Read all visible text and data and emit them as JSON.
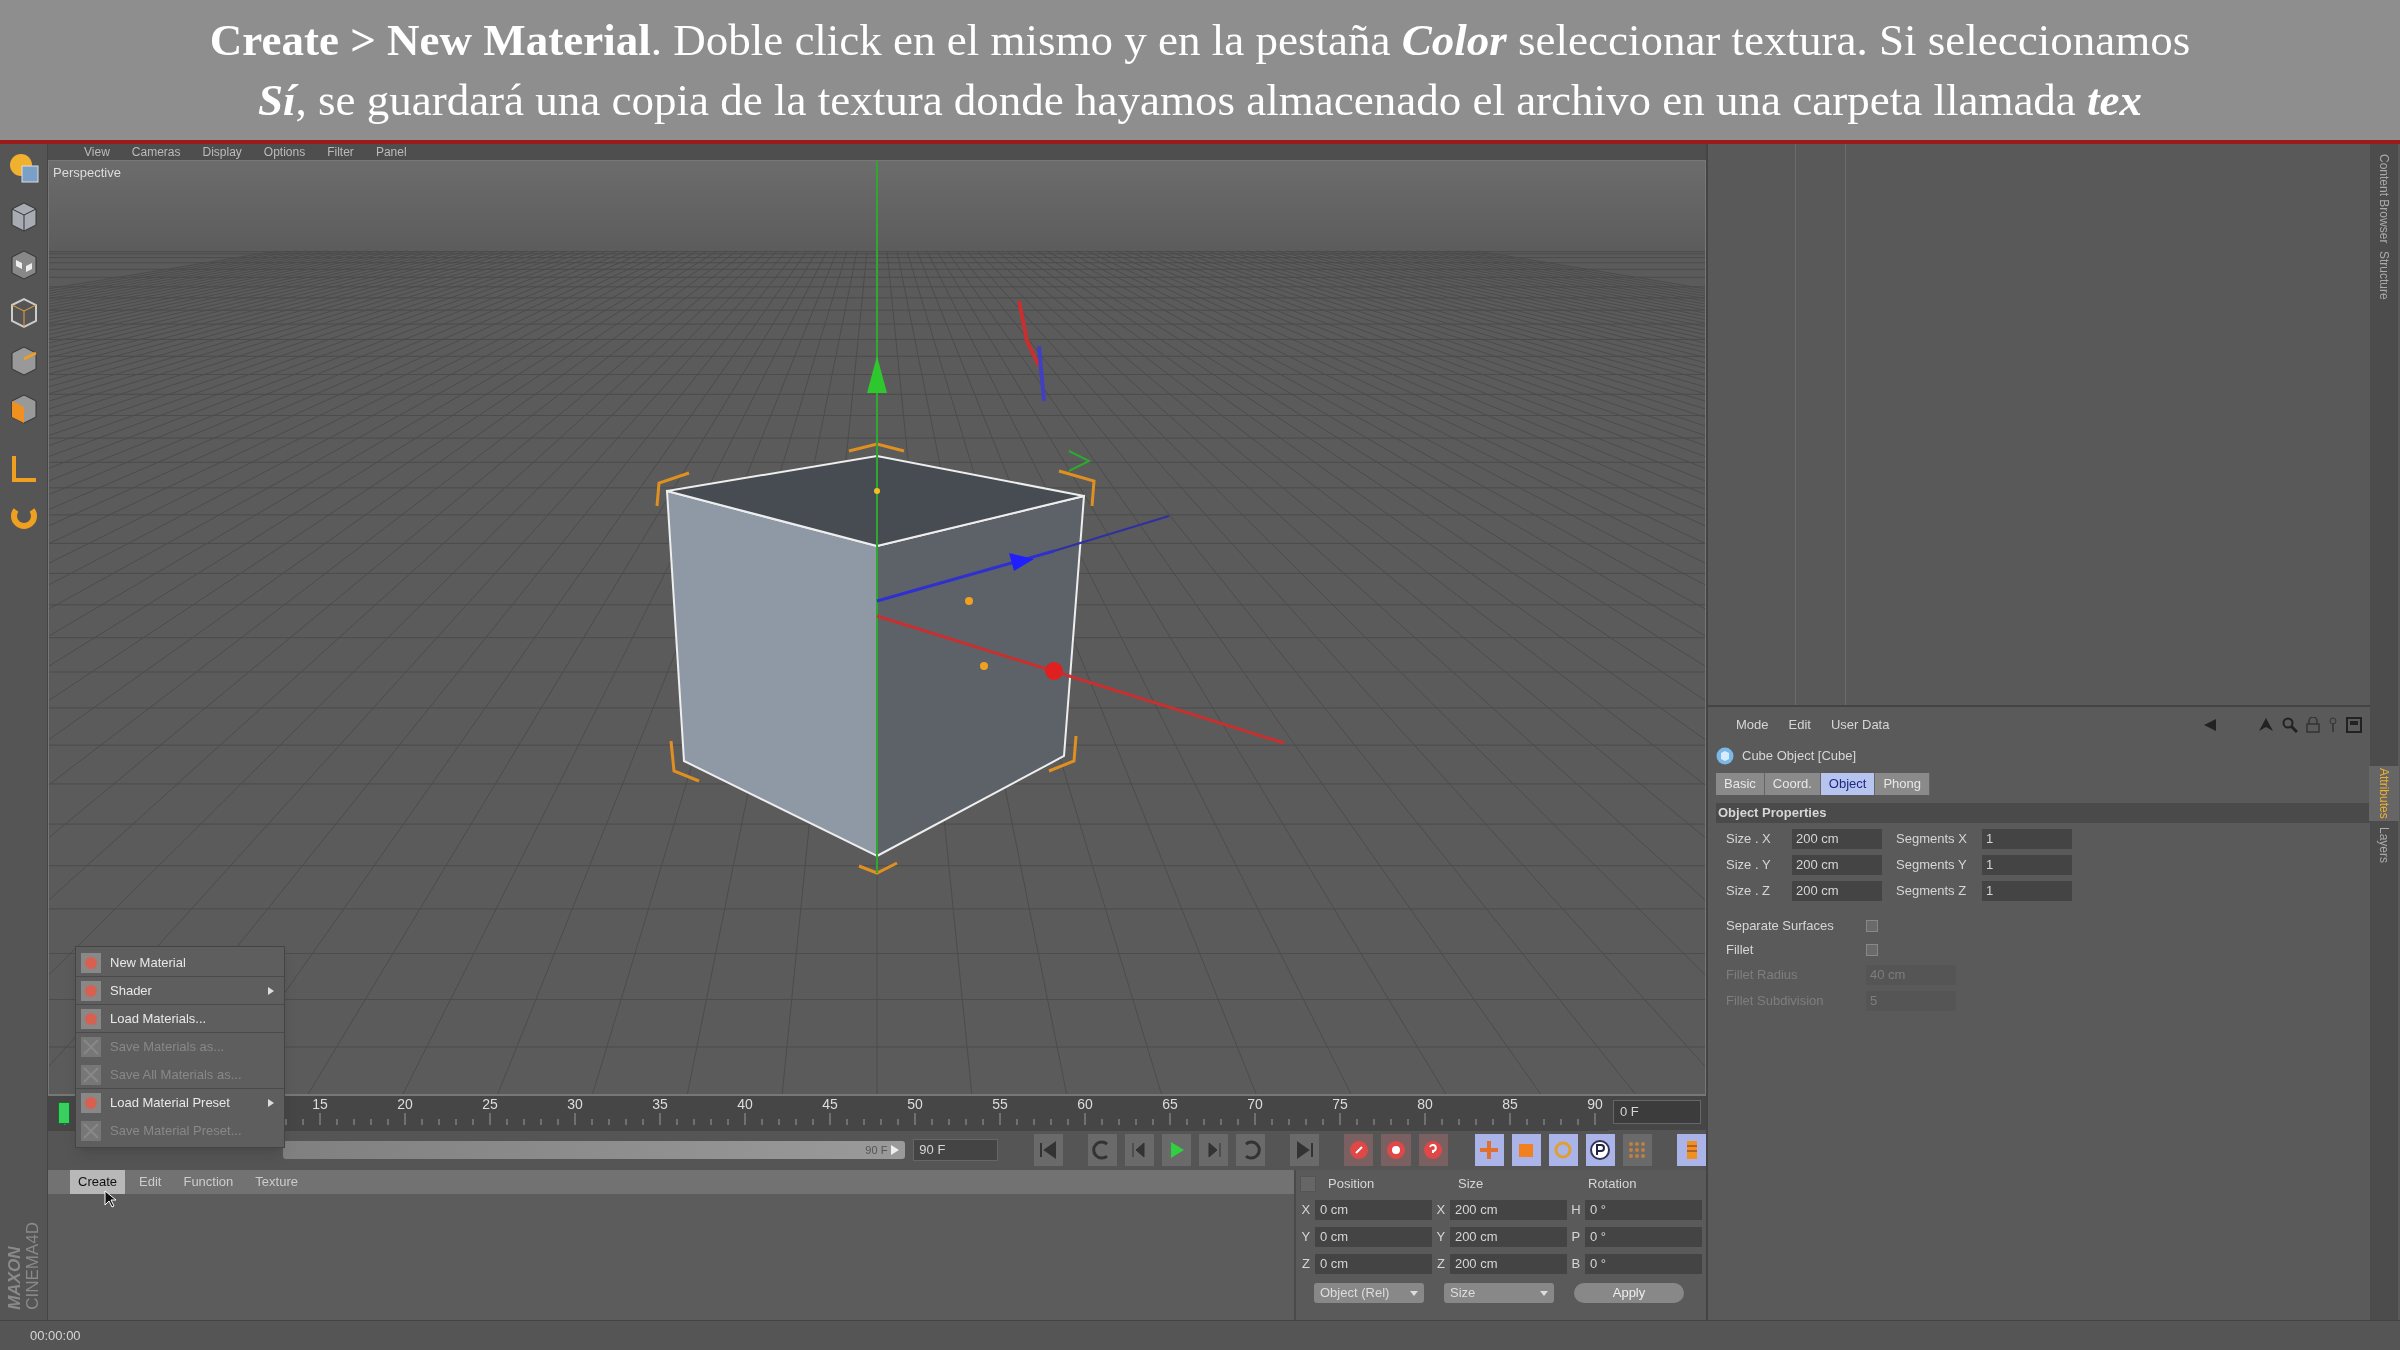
{
  "caption": {
    "lines": [
      "**Create > New Material**.  Doble click en el mismo y en la pestaña *Color* seleccionar textura. Si seleccionamos",
      "*Sí*, se guardará una copia de la textura donde hayamos almacenado el archivo en una carpeta llamada *tex*"
    ]
  },
  "viewport": {
    "menu": [
      "View",
      "Cameras",
      "Display",
      "Options",
      "Filter",
      "Panel"
    ],
    "label": "Perspective"
  },
  "create_menu": {
    "items": [
      {
        "label": "New Material",
        "disabled": false,
        "submenu": false,
        "separator_after": true
      },
      {
        "label": "Shader",
        "disabled": false,
        "submenu": true,
        "separator_after": true
      },
      {
        "label": "Load Materials...",
        "disabled": false,
        "submenu": false,
        "separator_after": true
      },
      {
        "label": "Save Materials as...",
        "disabled": true,
        "submenu": false,
        "separator_after": false
      },
      {
        "label": "Save All Materials as...",
        "disabled": true,
        "submenu": false,
        "separator_after": true
      },
      {
        "label": "Load Material Preset",
        "disabled": false,
        "submenu": true,
        "separator_after": false
      },
      {
        "label": "Save Material Preset...",
        "disabled": true,
        "submenu": false,
        "separator_after": false
      }
    ]
  },
  "timeline": {
    "labels": [
      "15",
      "20",
      "25",
      "30",
      "35",
      "40",
      "45",
      "50",
      "55",
      "60",
      "65",
      "70",
      "75",
      "80",
      "85",
      "90"
    ],
    "current_frame": "0 F"
  },
  "transport": {
    "slider_end": "90 F",
    "end_frame": "90 F"
  },
  "material_manager": {
    "menu": [
      {
        "label": "Create",
        "selected": true
      },
      {
        "label": "Edit",
        "selected": false
      },
      {
        "label": "Function",
        "selected": false
      },
      {
        "label": "Texture",
        "selected": false
      }
    ]
  },
  "coordinates": {
    "checked": false,
    "headers": [
      "Position",
      "Size",
      "Rotation"
    ],
    "rows": [
      {
        "axis": "X",
        "position": "0 cm",
        "size_axis": "X",
        "size": "200 cm",
        "rotation_axis": "H",
        "rotation": "0 °"
      },
      {
        "axis": "Y",
        "position": "0 cm",
        "size_axis": "Y",
        "size": "200 cm",
        "rotation_axis": "P",
        "rotation": "0 °"
      },
      {
        "axis": "Z",
        "position": "0 cm",
        "size_axis": "Z",
        "size": "200 cm",
        "rotation_axis": "B",
        "rotation": "0 °"
      }
    ],
    "mode": "Object (Rel)",
    "size_mode": "Size",
    "apply": "Apply"
  },
  "attributes": {
    "menu": [
      "Mode",
      "Edit",
      "User Data"
    ],
    "title": "Cube Object [Cube]",
    "tabs": [
      {
        "label": "Basic",
        "selected": false
      },
      {
        "label": "Coord.",
        "selected": false
      },
      {
        "label": "Object",
        "selected": true
      },
      {
        "label": "Phong",
        "selected": false
      }
    ],
    "section": "Object Properties",
    "size_rows": [
      {
        "label": "Size . X",
        "value": "200 cm",
        "seg_label": "Segments X",
        "seg_value": "1"
      },
      {
        "label": "Size . Y",
        "value": "200 cm",
        "seg_label": "Segments Y",
        "seg_value": "1"
      },
      {
        "label": "Size . Z",
        "value": "200 cm",
        "seg_label": "Segments Z",
        "seg_value": "1"
      }
    ],
    "checks": [
      {
        "label": "Separate Surfaces",
        "checked": false
      },
      {
        "label": "Fillet",
        "checked": false
      }
    ],
    "fillet": [
      {
        "label": "Fillet Radius",
        "value": "40 cm",
        "disabled": true
      },
      {
        "label": "Fillet Subdivision",
        "value": "5",
        "disabled": true
      }
    ]
  },
  "side_tabs": [
    {
      "label": "Content Browser",
      "selected": false
    },
    {
      "label": "Structure",
      "selected": false
    },
    {
      "label": "Attributes",
      "selected": true
    },
    {
      "label": "Layers",
      "selected": false
    }
  ],
  "logo": [
    "MAXON",
    "CINEMA4D"
  ],
  "status_bar": {
    "time": "00:00:00"
  }
}
